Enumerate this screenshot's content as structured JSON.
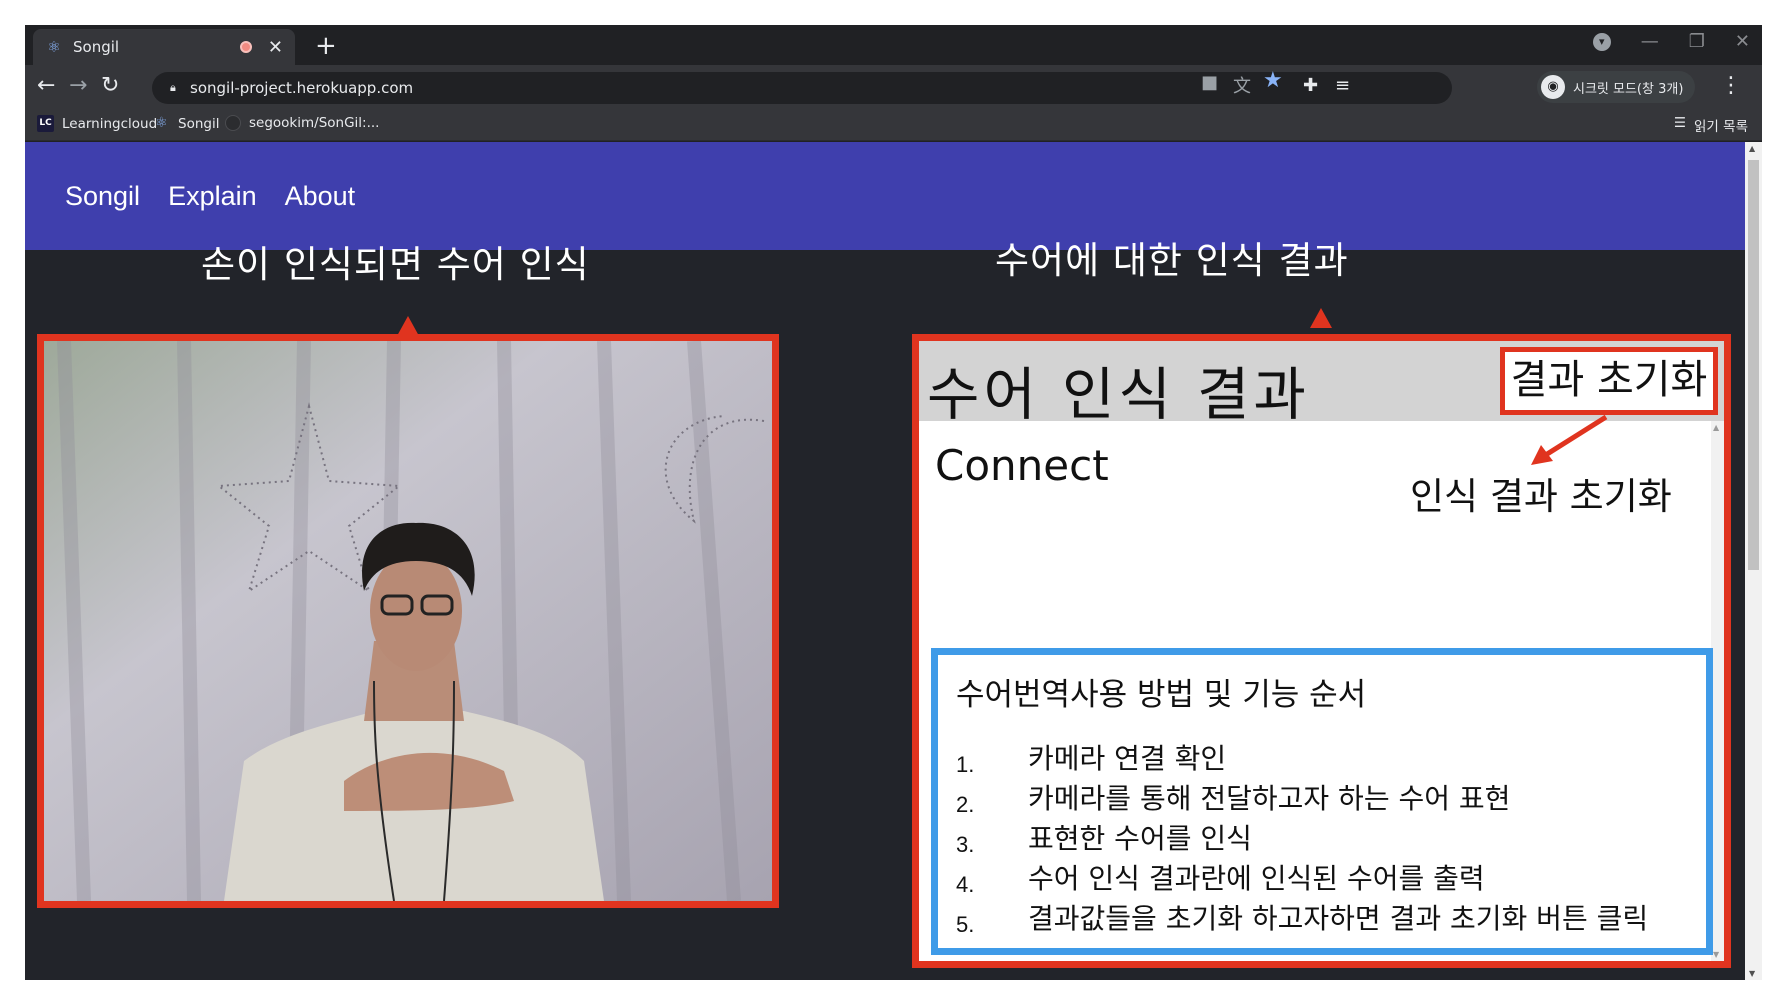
{
  "browser": {
    "tab_title": "Songil",
    "new_tab": "+",
    "tab_close": "✕",
    "url": "songil-project.herokuapp.com",
    "profile_label": "시크릿 모드(창 3개)",
    "bookmarks": [
      "Learningcloud",
      "Songil",
      "segookim/SonGil:..."
    ],
    "reading_list": "읽기 목록"
  },
  "nav": {
    "brand": "Songil",
    "explain": "Explain",
    "about": "About"
  },
  "annotations": {
    "left": "손이 인식되면 수어 인식",
    "right": "수어에 대한 인식 결과",
    "reset": "인식 결과 초기화"
  },
  "result": {
    "title": "수어 인식 결과",
    "reset_button": "결과 초기화",
    "text": "Connect"
  },
  "guide": {
    "title": "수어번역사용 방법 및 기능 순서",
    "steps": [
      {
        "num": "1.",
        "text": "카메라 연결 확인"
      },
      {
        "num": "2.",
        "text": "카메라를 통해 전달하고자 하는 수어 표현"
      },
      {
        "num": "3.",
        "text": "표현한 수어를 인식"
      },
      {
        "num": "4.",
        "text": "수어 인식 결과란에 인식된 수어를 출력"
      },
      {
        "num": "5.",
        "text": "결과값들을 초기화 하고자하면 결과 초기화 버튼 클릭"
      }
    ]
  },
  "colors": {
    "appbar": "#3f3fad",
    "annotation_red": "#e0341f",
    "annotation_blue": "#3f9be8"
  }
}
